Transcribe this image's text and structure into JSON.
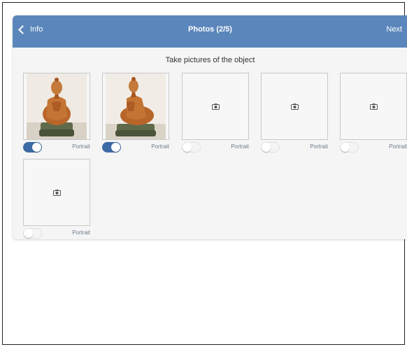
{
  "nav": {
    "back_label": "Info",
    "title": "Photos (2/5)",
    "next_label": "Next"
  },
  "instruction": "Take pictures of the object",
  "slots": [
    {
      "has_photo": true,
      "portrait_on": true,
      "label": "Portrait"
    },
    {
      "has_photo": true,
      "portrait_on": true,
      "label": "Portrait"
    },
    {
      "has_photo": false,
      "portrait_on": false,
      "label": "Portrait"
    },
    {
      "has_photo": false,
      "portrait_on": false,
      "label": "Portrait"
    },
    {
      "has_photo": false,
      "portrait_on": false,
      "label": "Portrait"
    },
    {
      "has_photo": false,
      "portrait_on": false,
      "label": "Portrait"
    }
  ],
  "icons": {
    "back": "chevron-left-icon",
    "empty_slot": "camera-icon"
  },
  "colors": {
    "nav_bar": "#5b86bb",
    "toggle_on": "#3c6aa4",
    "label_text": "#6c7a8c"
  }
}
